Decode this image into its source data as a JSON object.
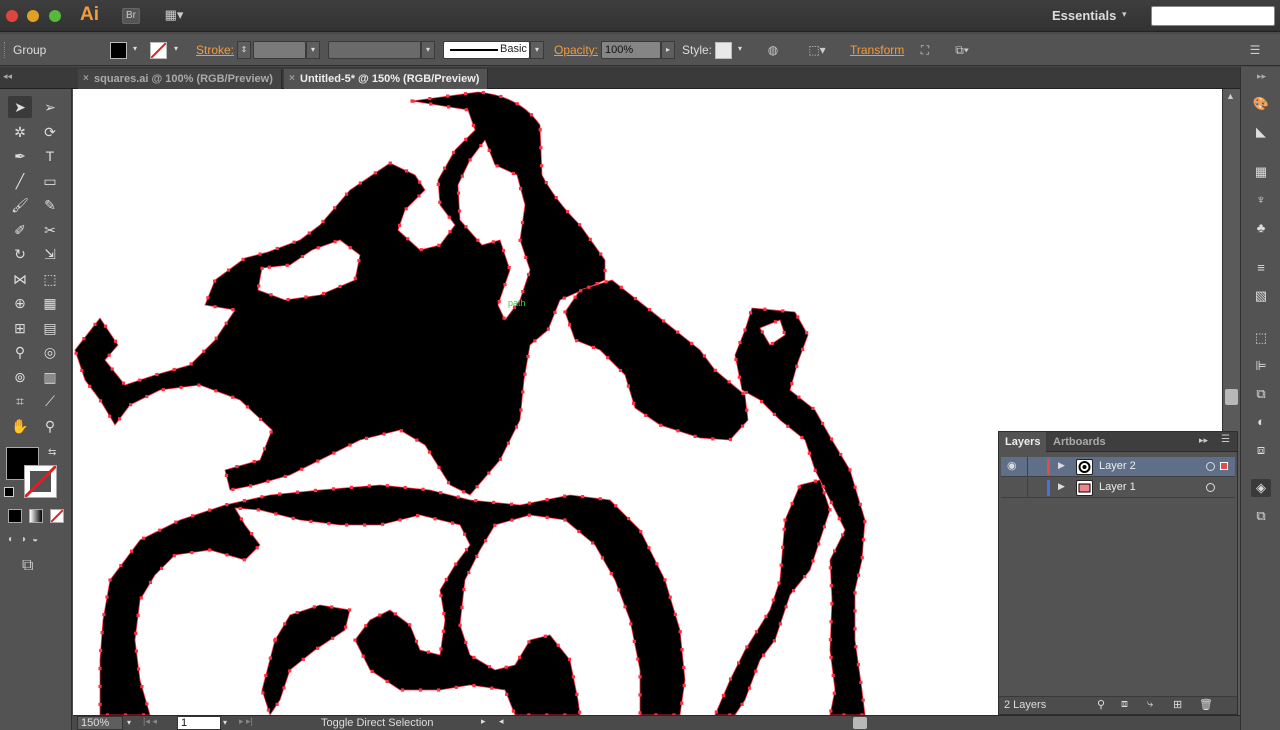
{
  "app": {
    "name": "Ai",
    "bridge_label": "Br",
    "layout_label": "▦▾"
  },
  "workspace": {
    "label": "Essentials",
    "caret": "▾"
  },
  "search": {
    "placeholder": ""
  },
  "control": {
    "selection_type": "Group",
    "stroke_label": "Stroke:",
    "brush_label": "Basic",
    "opacity_label": "Opacity:",
    "opacity_value": "100%",
    "style_label": "Style:",
    "transform_label": "Transform"
  },
  "tabs": [
    {
      "label": "squares.ai @ 100% (RGB/Preview)",
      "close": "×"
    },
    {
      "label": "Untitled-5* @ 150% (RGB/Preview)",
      "close": "×"
    }
  ],
  "canvas": {
    "hint_label": "path"
  },
  "status": {
    "zoom": "150%",
    "artboard": "1",
    "message": "Toggle Direct Selection"
  },
  "layers_panel": {
    "tabs": [
      "Layers",
      "Artboards"
    ],
    "layers": [
      {
        "name": "Layer 2",
        "color": "#e04b4b"
      },
      {
        "name": "Layer 1",
        "color": "#4b6fe0"
      }
    ],
    "footer_count": "2 Layers"
  },
  "colors": {
    "accent": "#f29c3d",
    "path_anchor": "#ff3344",
    "selection_row": "#5e6f87"
  }
}
